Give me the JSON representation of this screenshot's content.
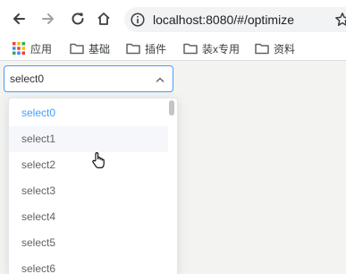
{
  "browser": {
    "address_bar": {
      "url": "localhost:8080/#/optimize"
    }
  },
  "bookmarks": [
    {
      "label": "应用",
      "icon": "apps-grid-icon"
    },
    {
      "label": "基础",
      "icon": "folder-icon"
    },
    {
      "label": "插件",
      "icon": "folder-icon"
    },
    {
      "label": "装x专用",
      "icon": "folder-icon"
    },
    {
      "label": "资料",
      "icon": "folder-icon"
    }
  ],
  "select": {
    "value": "select0",
    "options": [
      "select0",
      "select1",
      "select2",
      "select3",
      "select4",
      "select5",
      "select6"
    ],
    "selected_option": "select0",
    "hovered_option": "select1"
  },
  "colors": {
    "accent": "#409eff",
    "option_text": "#606266",
    "hover_background": "#f5f7fa",
    "page_background": "#f3f3f1"
  }
}
